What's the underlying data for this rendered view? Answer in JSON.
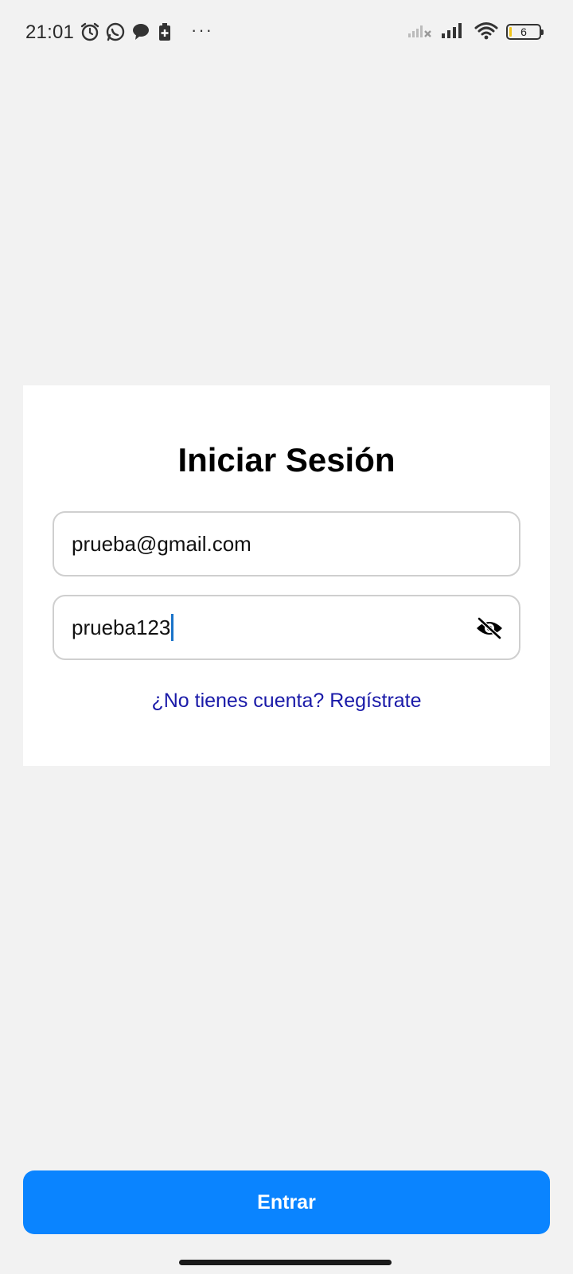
{
  "status_bar": {
    "time": "21:01",
    "dots": "···",
    "battery_level": "6",
    "icons_left": [
      "alarm-icon",
      "whatsapp-icon",
      "chat-bubble-icon",
      "battery-saver-icon"
    ],
    "icons_right": [
      "no-signal-icon",
      "signal-icon",
      "wifi-icon",
      "battery-icon"
    ]
  },
  "login": {
    "title": "Iniciar Sesión",
    "email_value": "prueba@gmail.com",
    "password_value": "prueba123",
    "register_link": "¿No tienes cuenta? Regístrate"
  },
  "footer": {
    "submit_label": "Entrar"
  },
  "colors": {
    "background": "#f2f2f2",
    "card": "#ffffff",
    "primary": "#0a84ff",
    "link": "#1a1aa8",
    "input_border": "#cfcfcf"
  }
}
